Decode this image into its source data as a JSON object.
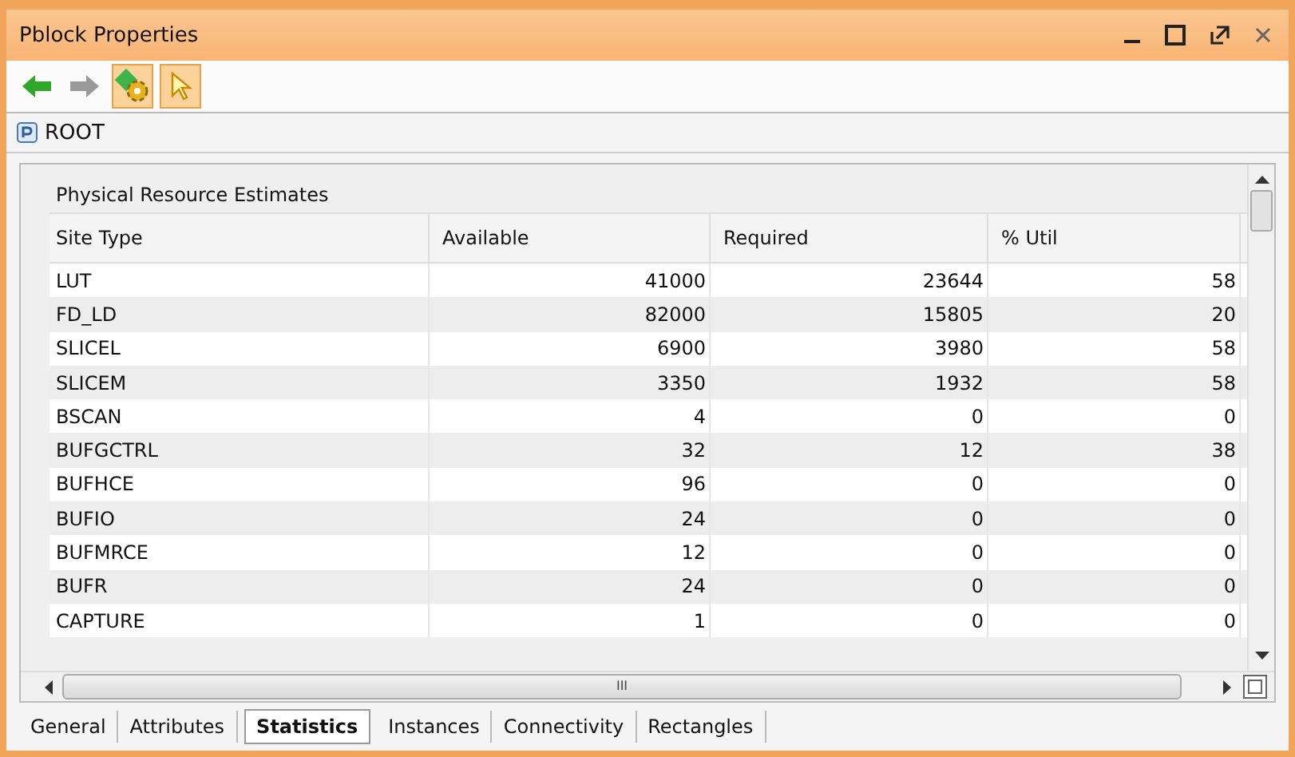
{
  "window": {
    "title": "Pblock Properties"
  },
  "toolbar": [
    {
      "kind": "back",
      "disabled": false
    },
    {
      "kind": "forward",
      "disabled": true
    },
    {
      "kind": "gear",
      "selected": true
    },
    {
      "kind": "pointer",
      "selected": true
    }
  ],
  "breadcrumb": "ROOT",
  "section": {
    "title": "Physical Resource Estimates"
  },
  "table": {
    "columns": [
      "Site Type",
      "Available",
      "Required",
      "% Util"
    ],
    "rows": [
      [
        "LUT",
        "41000",
        "23644",
        "58"
      ],
      [
        "FD_LD",
        "82000",
        "15805",
        "20"
      ],
      [
        "SLICEL",
        "6900",
        "3980",
        "58"
      ],
      [
        "SLICEM",
        "3350",
        "1932",
        "58"
      ],
      [
        "BSCAN",
        "4",
        "0",
        "0"
      ],
      [
        "BUFGCTRL",
        "32",
        "12",
        "38"
      ],
      [
        "BUFHCE",
        "96",
        "0",
        "0"
      ],
      [
        "BUFIO",
        "24",
        "0",
        "0"
      ],
      [
        "BUFMRCE",
        "12",
        "0",
        "0"
      ],
      [
        "BUFR",
        "24",
        "0",
        "0"
      ],
      [
        "CAPTURE",
        "1",
        "0",
        "0"
      ]
    ]
  },
  "scrollbar": {
    "horizontal_grip": "III"
  },
  "tabs": [
    {
      "label": "General",
      "selected": false
    },
    {
      "label": "Attributes",
      "selected": false
    },
    {
      "label": "Statistics",
      "selected": true
    },
    {
      "label": "Instances",
      "selected": false
    },
    {
      "label": "Connectivity",
      "selected": false
    },
    {
      "label": "Rectangles",
      "selected": false
    }
  ]
}
